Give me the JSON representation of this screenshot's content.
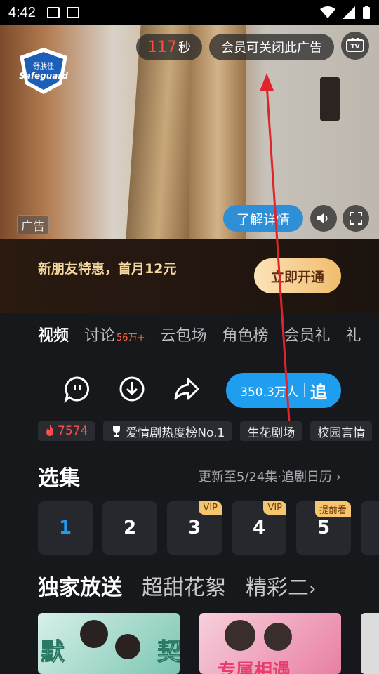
{
  "status_bar": {
    "time": "4:42"
  },
  "ad": {
    "countdown_value": "117",
    "countdown_unit": "秒",
    "close_ad_label": "会员可关闭此广告",
    "tv_label": "TV",
    "ad_tag": "广告",
    "learn_more": "了解详情",
    "brand_line1": "舒肤佳",
    "brand_line2": "Safeguard"
  },
  "promo": {
    "text": "新朋友特惠，首月12元",
    "button": "立即开通"
  },
  "tabs": [
    {
      "label": "视频",
      "badge": ""
    },
    {
      "label": "讨论",
      "badge": "56万+"
    },
    {
      "label": "云包场",
      "badge": ""
    },
    {
      "label": "角色榜",
      "badge": ""
    },
    {
      "label": "会员礼",
      "badge": ""
    },
    {
      "label": "礼",
      "badge": ""
    }
  ],
  "follow": {
    "count": "350.3万人",
    "label": "追"
  },
  "tags": {
    "hot": "7574",
    "rank": "爱情剧热度榜No.1",
    "t1": "生花剧场",
    "t2": "校园言情"
  },
  "episodes": {
    "title": "选集",
    "update": "更新至5/24集·追剧日历",
    "items": [
      {
        "num": "1",
        "badge": ""
      },
      {
        "num": "2",
        "badge": ""
      },
      {
        "num": "3",
        "badge": "VIP"
      },
      {
        "num": "4",
        "badge": "VIP"
      },
      {
        "num": "5",
        "badge": "提前看"
      }
    ]
  },
  "sections": {
    "s1": "独家放送",
    "s2": "超甜花絮",
    "s3": "精彩二"
  },
  "thumb_text": {
    "t1a": "默",
    "t1b": "契",
    "t2": "专属相遇"
  },
  "colors": {
    "accent": "#1f9ef0",
    "hot": "#ff4e4e",
    "vip": "#f6c66f"
  }
}
